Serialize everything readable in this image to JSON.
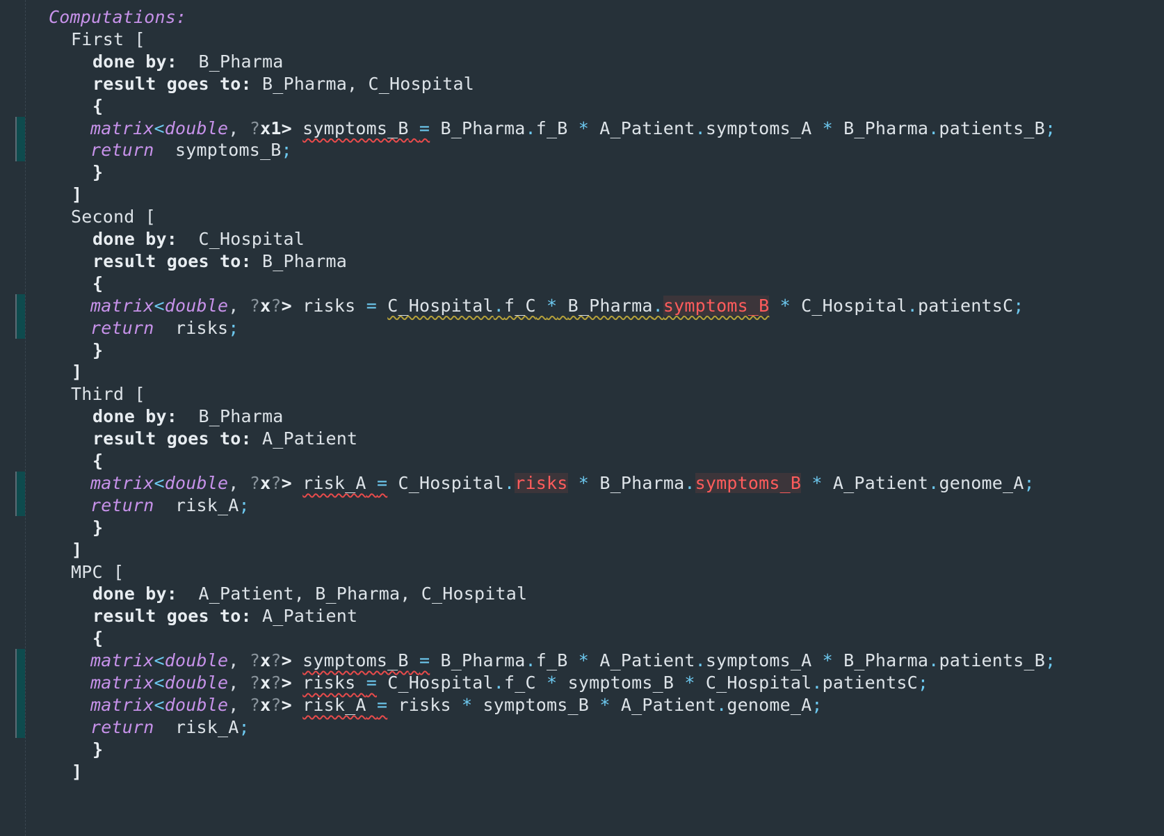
{
  "header": "Computations:",
  "labels": {
    "done_by": "done by:",
    "result_goes_to": "result goes to:",
    "return": "return",
    "matrix": "matrix"
  },
  "blocks": [
    {
      "name": "First [",
      "done_by": "B_Pharma",
      "result_goes_to": "B_Pharma, C_Hospital",
      "statements": [
        "matrix<double, ?x1> symptoms_B = B_Pharma.f_B * A_Patient.symptoms_A * B_Pharma.patients_B;"
      ],
      "return_value": "symptoms_B;"
    },
    {
      "name": "Second [",
      "done_by": "C_Hospital",
      "result_goes_to": "B_Pharma",
      "statements": [
        "matrix<double, ?x?> risks = C_Hospital.f_C * B_Pharma.symptoms_B * C_Hospital.patientsC;"
      ],
      "return_value": "risks;"
    },
    {
      "name": "Third [",
      "done_by": "B_Pharma",
      "result_goes_to": "A_Patient",
      "statements": [
        "matrix<double, ?x?> risk_A = C_Hospital.risks * B_Pharma.symptoms_B * A_Patient.genome_A;"
      ],
      "return_value": "risk_A;"
    },
    {
      "name": "MPC [",
      "done_by": "A_Patient, B_Pharma, C_Hospital",
      "result_goes_to": "A_Patient",
      "statements": [
        "matrix<double, ?x?> symptoms_B = B_Pharma.f_B * A_Patient.symptoms_A * B_Pharma.patients_B;",
        "matrix<double, ?x?> risks = C_Hospital.f_C * symptoms_B * C_Hospital.patientsC;",
        "matrix<double, ?x?> risk_A = risks * symptoms_B * A_Patient.genome_A;"
      ],
      "return_value": "risk_A;"
    }
  ],
  "colors": {
    "background": "#263139",
    "keyword": "#c792ea",
    "operator": "#6dc9f0",
    "error": "#ff5c5c"
  }
}
